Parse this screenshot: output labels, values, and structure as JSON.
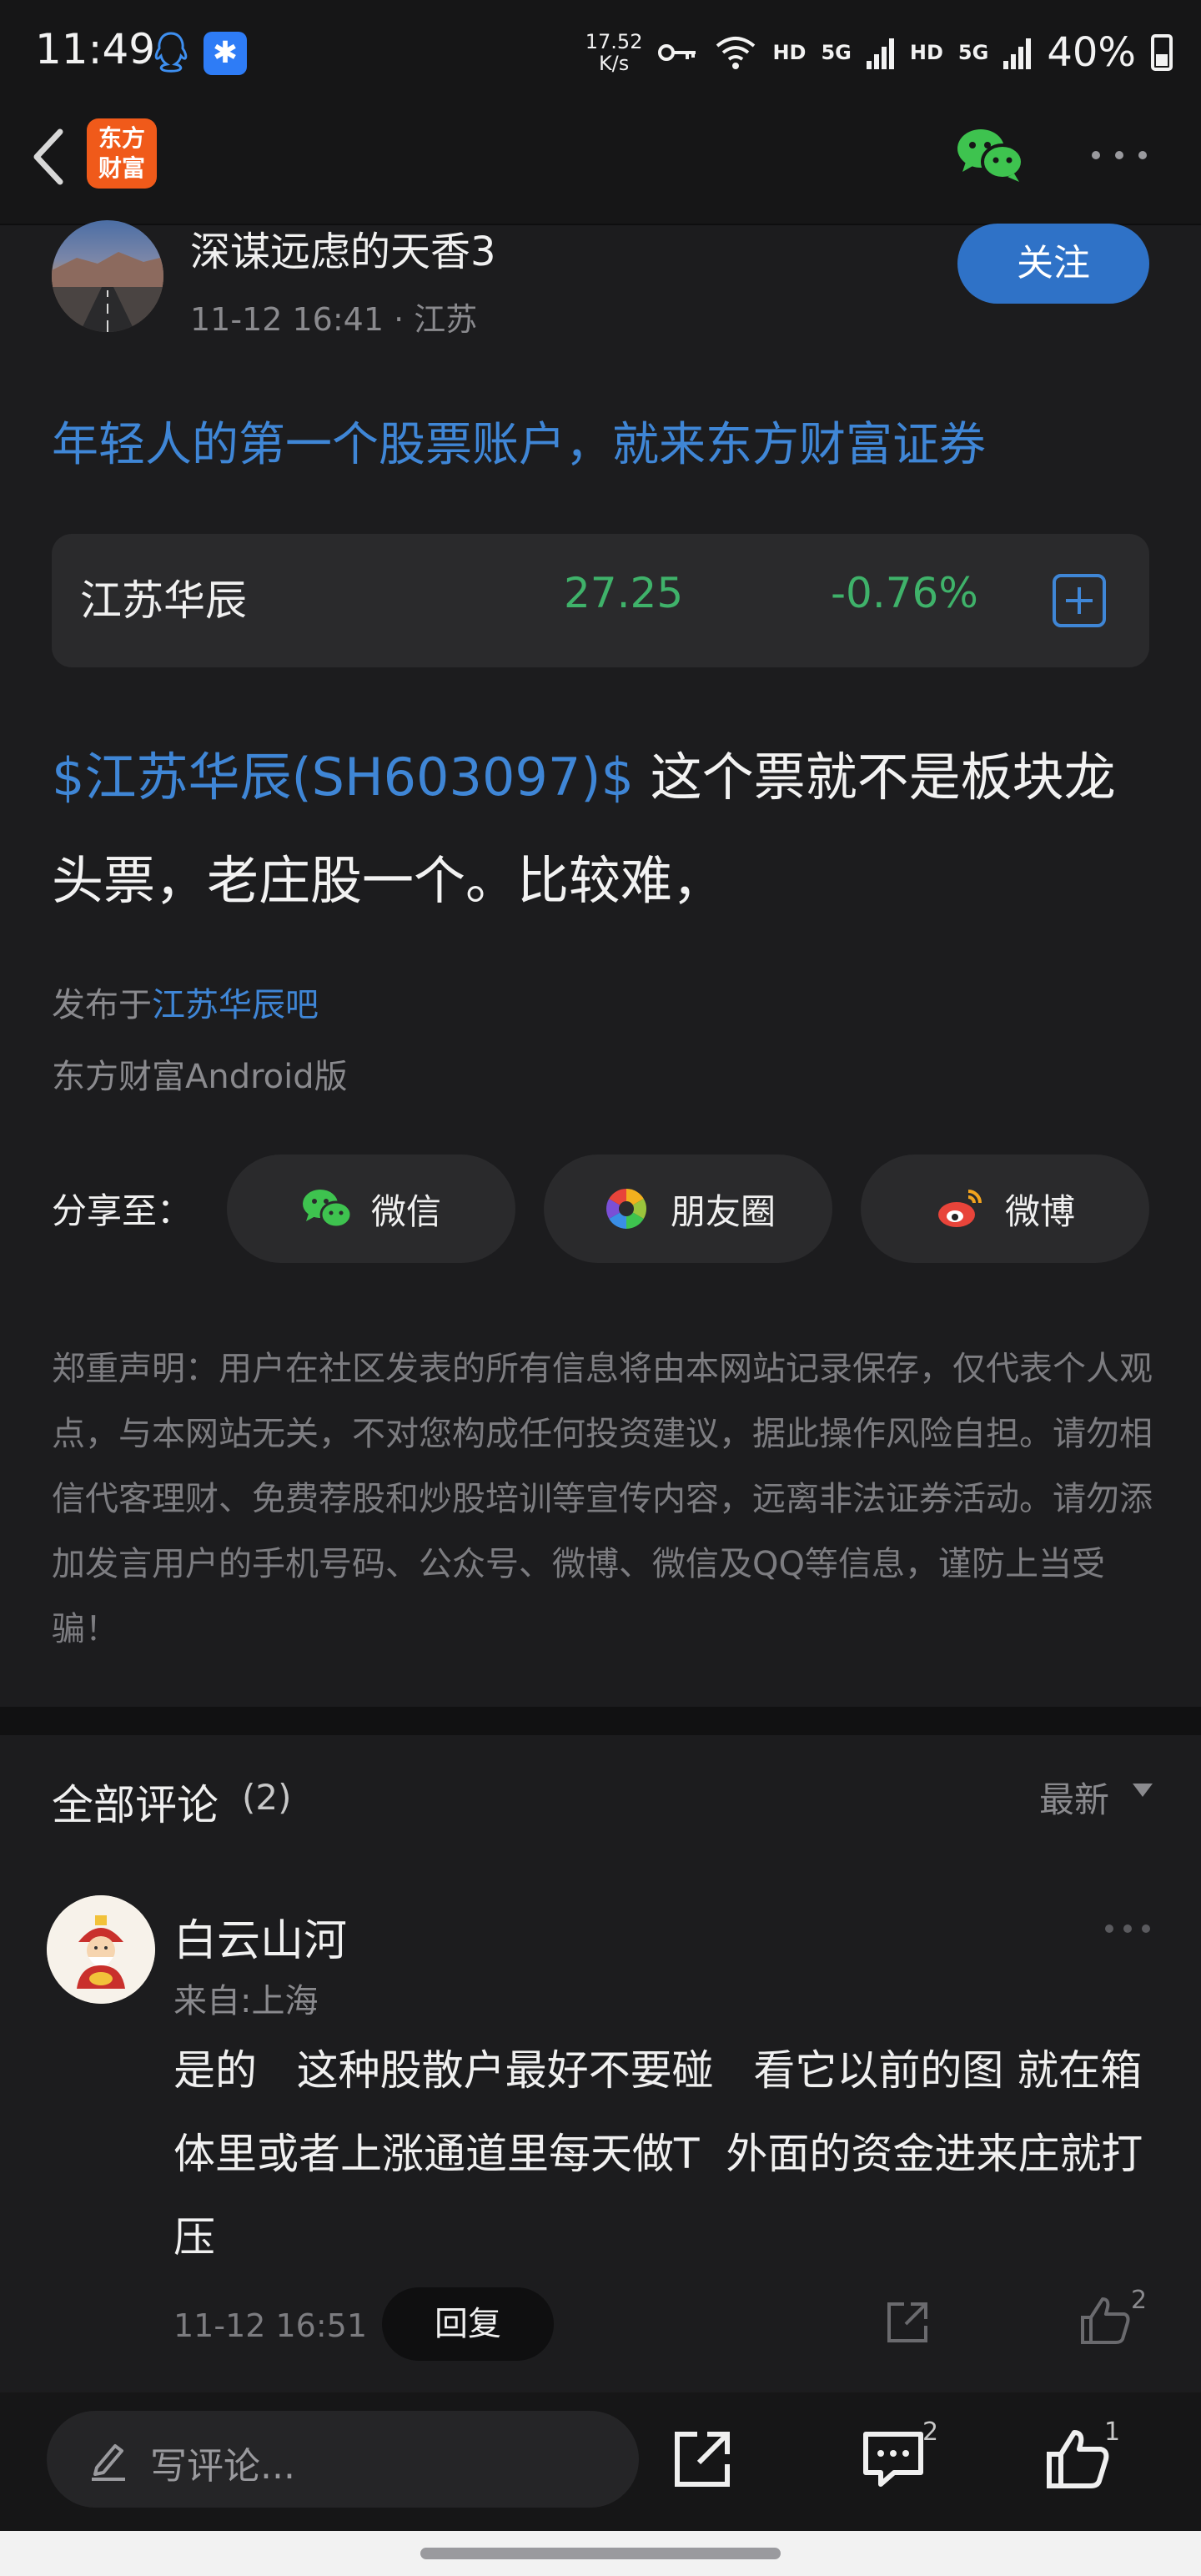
{
  "status_bar": {
    "time": "11:49",
    "net_speed_value": "17.52",
    "net_speed_unit": "K/s",
    "hd1": "HD",
    "sig1": "5G",
    "hd2": "HD",
    "sig2": "5G",
    "battery": "40%"
  },
  "nav": {
    "logo_line1": "东方",
    "logo_line2": "财富"
  },
  "post": {
    "author": "深谋远虑的天香3",
    "time": "11-12 16:41",
    "location": "· 江苏",
    "follow_label": "关注",
    "ad_text": "年轻人的第一个股票账户，就来东方财富证券",
    "stock": {
      "name": "江苏华辰",
      "price": "27.25",
      "change": "-0.76%"
    },
    "stock_tag": "$江苏华辰(SH603097)$",
    "body": " 这个票就不是板块龙头票，老庄股一个。比较难，",
    "published_prefix": "发布于",
    "published_bar": "江苏华辰吧",
    "client": "东方财富Android版"
  },
  "share": {
    "label": "分享至：",
    "wechat": "微信",
    "moments": "朋友圈",
    "weibo": "微博"
  },
  "disclaimer": "郑重声明：用户在社区发表的所有信息将由本网站记录保存，仅代表个人观点，与本网站无关，不对您构成任何投资建议，据此操作风险自担。请勿相信代客理财、免费荐股和炒股培训等宣传内容，远离非法证券活动。请勿添加发言用户的手机号码、公众号、微博、微信及QQ等信息，谨防上当受骗！",
  "comments": {
    "title": "全部评论",
    "count": "(2)",
    "sort": "最新",
    "items": [
      {
        "user": "白云山河",
        "from": "来自:上海",
        "text": "是的   这种股散户最好不要碰   看它以前的图 就在箱体里或者上涨通道里每天做T  外面的资金进来庄就打压",
        "time": "11-12 16:51",
        "reply_label": "回复",
        "likes": "2"
      }
    ]
  },
  "bottom_bar": {
    "placeholder": "写评论...",
    "comment_count": "2",
    "like_count": "1"
  }
}
